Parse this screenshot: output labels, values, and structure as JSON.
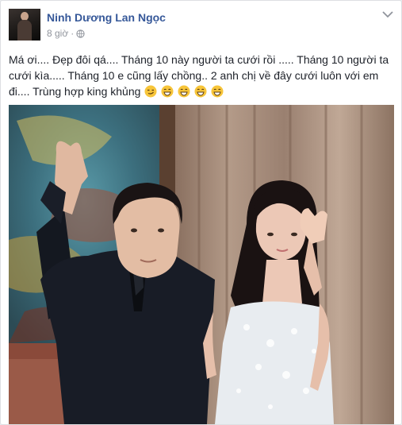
{
  "post": {
    "author": "Ninh Dương Lan Ngọc",
    "time": "8 giờ",
    "separator": "·",
    "text_line1": "Má ơi.... Đẹp đôi qá.... Tháng 10 này người ta cưới rồi ..... Tháng 10 người ta",
    "text_line2": "cưới kìa..... Tháng 10 e cũng lấy chồng.. 2 anh chị về đây cưới luôn với em",
    "text_line3": "đi.... Trùng hợp king khủng"
  },
  "icons": {
    "privacy": "globe-icon",
    "menu": "chevron-down-icon",
    "emoji": [
      "smirk-emoji-icon",
      "grin-emoji-icon",
      "grin-emoji-icon",
      "grin-emoji-icon",
      "grin-emoji-icon"
    ]
  },
  "colors": {
    "author_link": "#365899",
    "meta_text": "#90949c",
    "body_text": "#1d2129"
  }
}
